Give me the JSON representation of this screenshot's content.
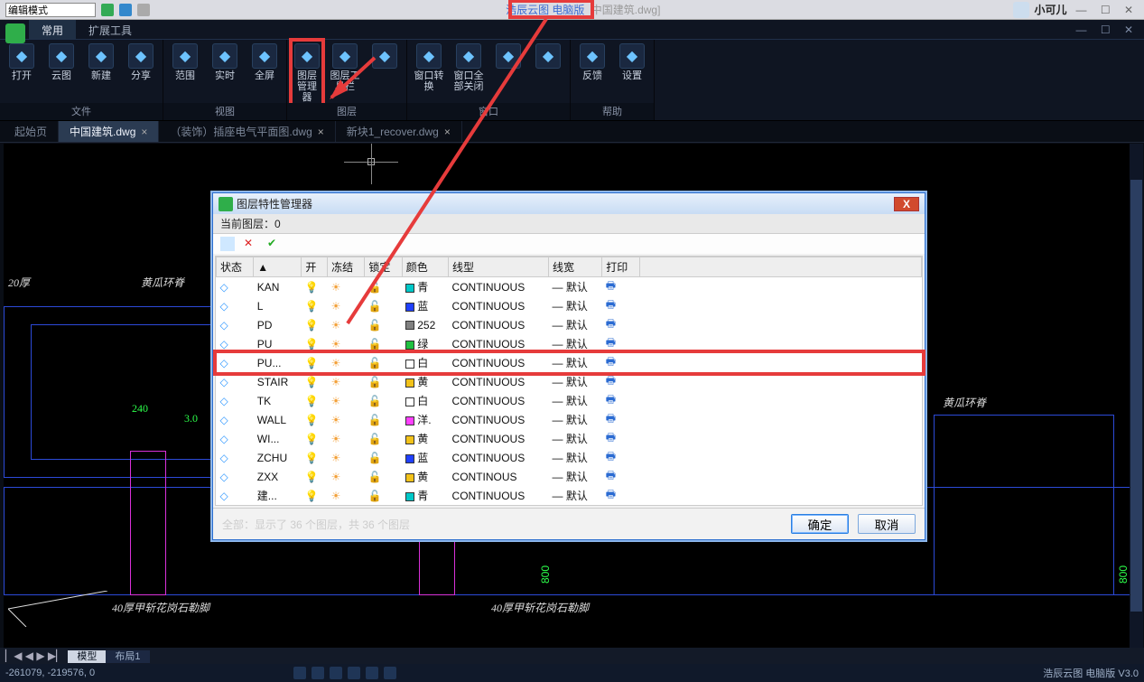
{
  "title": {
    "editmode": "编辑模式",
    "app": "浩辰云图 电脑版",
    "doc_suffix": "中国建筑.dwg]",
    "user": "小可儿"
  },
  "ribbonTabs": [
    "常用",
    "扩展工具"
  ],
  "ribbonGroups": [
    {
      "label": "文件",
      "buttons": [
        {
          "label": "打开",
          "icon": "folder-icon"
        },
        {
          "label": "云图",
          "icon": "cloud-icon"
        },
        {
          "label": "新建",
          "icon": "new-icon"
        },
        {
          "label": "分享",
          "icon": "share-icon"
        }
      ]
    },
    {
      "label": "视图",
      "buttons": [
        {
          "label": "范围",
          "icon": "extent-icon"
        },
        {
          "label": "实时",
          "icon": "zoom-icon"
        },
        {
          "label": "全屏",
          "icon": "fullscreen-icon"
        }
      ]
    },
    {
      "label": "图层",
      "buttons": [
        {
          "label": "图层管理器",
          "icon": "layers-manager-icon",
          "hi": true
        },
        {
          "label": "图层工具栏",
          "icon": "layers-toolbar-icon"
        },
        {
          "label": "",
          "icon": "layers-more-icon"
        }
      ]
    },
    {
      "label": "窗口",
      "buttons": [
        {
          "label": "窗口转换",
          "icon": "window-switch-icon"
        },
        {
          "label": "窗口全部关闭",
          "icon": "window-closeall-icon"
        },
        {
          "label": "",
          "icon": "tile-v-icon"
        },
        {
          "label": "",
          "icon": "tile-h-icon"
        }
      ]
    },
    {
      "label": "帮助",
      "buttons": [
        {
          "label": "反馈",
          "icon": "feedback-icon"
        },
        {
          "label": "设置",
          "icon": "settings-icon"
        }
      ]
    }
  ],
  "docTabs": [
    {
      "label": "起始页"
    },
    {
      "label": "中国建筑.dwg",
      "active": true,
      "closable": true
    },
    {
      "label": "（装饰）插座电气平面图.dwg",
      "closable": true
    },
    {
      "label": "新块1_recover.dwg",
      "closable": true
    }
  ],
  "viewTabs": {
    "nav": "▏◀ ◀ ▶ ▶▏",
    "items": [
      {
        "label": "模型",
        "active": true
      },
      {
        "label": "布局1"
      }
    ]
  },
  "status": {
    "coords": "-261079, -219576, 0",
    "brand": "浩辰云图 电脑版 V3.0"
  },
  "dialog": {
    "title": "图层特性管理器",
    "current": "当前图层：0",
    "headers": [
      "状态",
      "▲",
      "开",
      "冻结",
      "锁定",
      "颜色",
      "线型",
      "线宽",
      "打印"
    ],
    "rows": [
      {
        "name": "KAN",
        "colorSw": "#00c8c8",
        "colorTxt": "青",
        "lt": "CONTINUOUS",
        "lw": "— 默认"
      },
      {
        "name": "L",
        "colorSw": "#2040ff",
        "colorTxt": "蓝",
        "lt": "CONTINUOUS",
        "lw": "— 默认"
      },
      {
        "name": "PD",
        "colorSw": "#808080",
        "colorTxt": "252",
        "lt": "CONTINUOUS",
        "lw": "— 默认"
      },
      {
        "name": "PU",
        "colorSw": "#20c040",
        "colorTxt": "绿",
        "lt": "CONTINUOUS",
        "lw": "— 默认"
      },
      {
        "name": "PU...",
        "colorSw": "#ffffff",
        "colorTxt": "白",
        "lt": "CONTINUOUS",
        "lw": "— 默认",
        "hi": true
      },
      {
        "name": "STAIR",
        "colorSw": "#f2c21a",
        "colorTxt": "黄",
        "lt": "CONTINUOUS",
        "lw": "— 默认"
      },
      {
        "name": "TK",
        "colorSw": "#ffffff",
        "colorTxt": "白",
        "lt": "CONTINUOUS",
        "lw": "— 默认"
      },
      {
        "name": "WALL",
        "colorSw": "#ff40ff",
        "colorTxt": "洋.",
        "lt": "CONTINUOUS",
        "lw": "— 默认"
      },
      {
        "name": "WI...",
        "colorSw": "#f2c21a",
        "colorTxt": "黄",
        "lt": "CONTINUOUS",
        "lw": "— 默认"
      },
      {
        "name": "ZCHU",
        "colorSw": "#2040ff",
        "colorTxt": "蓝",
        "lt": "CONTINUOUS",
        "lw": "— 默认"
      },
      {
        "name": "ZXX",
        "colorSw": "#f2c21a",
        "colorTxt": "黄",
        "lt": "CONTINOUS",
        "lw": "— 默认"
      },
      {
        "name": "建...",
        "colorSw": "#00c8c8",
        "colorTxt": "青",
        "lt": "CONTINUOUS",
        "lw": "— 默认"
      }
    ],
    "footer": "全部：显示了 36 个图层，共 36 个图层",
    "ok": "确定",
    "cancel": "取消"
  },
  "canvas": {
    "label20": "20厚",
    "hg": "黄瓜环脊",
    "d240": "240",
    "d30": "3.0",
    "skirt": "40厚甲斩花岗石勒脚",
    "d800": "800"
  }
}
